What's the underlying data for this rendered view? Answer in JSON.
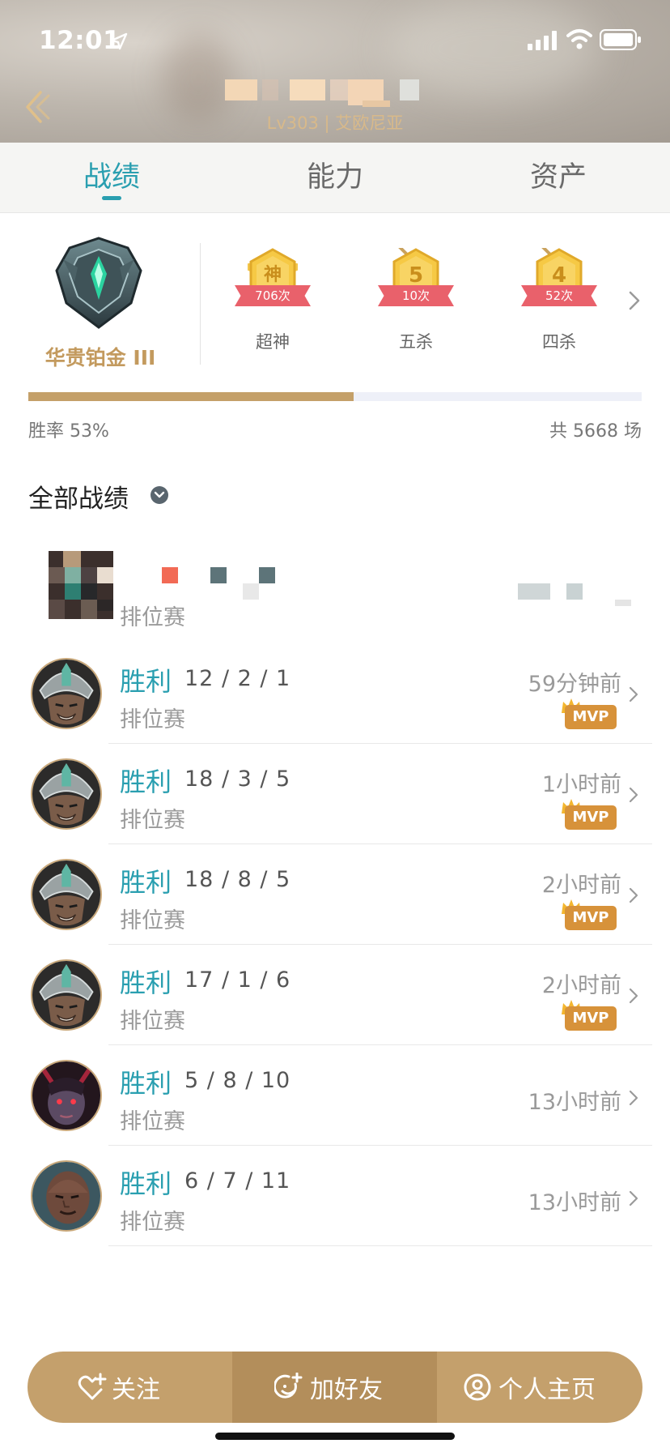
{
  "status_bar": {
    "time": "12:01"
  },
  "profile": {
    "level_region": "Lv303 | 艾欧尼亚"
  },
  "tabs": [
    {
      "label": "战绩",
      "active": true
    },
    {
      "label": "能力",
      "active": false
    },
    {
      "label": "资产",
      "active": false
    }
  ],
  "rank": {
    "name": "华贵铂金 III"
  },
  "badges": [
    {
      "icon_text": "神",
      "count": "706次",
      "label": "超神"
    },
    {
      "icon_text": "5",
      "count": "10次",
      "label": "五杀"
    },
    {
      "icon_text": "4",
      "count": "52次",
      "label": "四杀"
    }
  ],
  "stats": {
    "win_rate_text": "胜率 53%",
    "win_rate": 0.53,
    "total_text": "共 5668 场"
  },
  "section": {
    "title": "全部战绩"
  },
  "blurred_row": {
    "mode": "排位赛"
  },
  "matches": [
    {
      "result": "胜利",
      "kda": "12 / 2 / 1",
      "mode": "排位赛",
      "time": "59分钟前",
      "mvp": "MVP",
      "champion_icon": "helmet-warrior"
    },
    {
      "result": "胜利",
      "kda": "18 / 3 / 5",
      "mode": "排位赛",
      "time": "1小时前",
      "mvp": "MVP",
      "champion_icon": "helmet-warrior"
    },
    {
      "result": "胜利",
      "kda": "18 / 8 / 5",
      "mode": "排位赛",
      "time": "2小时前",
      "mvp": "MVP",
      "champion_icon": "helmet-warrior"
    },
    {
      "result": "胜利",
      "kda": "17 / 1 / 6",
      "mode": "排位赛",
      "time": "2小时前",
      "mvp": "MVP",
      "champion_icon": "helmet-warrior"
    },
    {
      "result": "胜利",
      "kda": "5 / 8 / 10",
      "mode": "排位赛",
      "time": "13小时前",
      "mvp": null,
      "champion_icon": "dark-horned"
    },
    {
      "result": "胜利",
      "kda": "6 / 7 / 11",
      "mode": "排位赛",
      "time": "13小时前",
      "mvp": null,
      "champion_icon": "bald-fighter"
    }
  ],
  "actions": [
    {
      "label": "关注",
      "icon": "heart-plus-icon"
    },
    {
      "label": "加好友",
      "icon": "add-friend-icon"
    },
    {
      "label": "个人主页",
      "icon": "profile-icon"
    }
  ],
  "colors": {
    "accent": "#2a9fb0",
    "gold": "#c4a069",
    "badge_ribbon": "#e9616b",
    "mvp": "#d7923a"
  }
}
